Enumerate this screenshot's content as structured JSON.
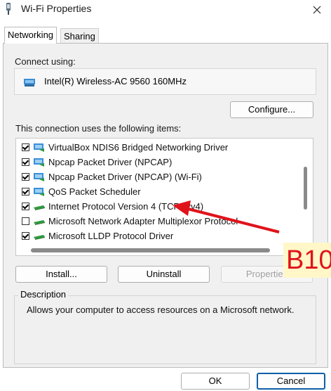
{
  "window": {
    "title": "Wi-Fi Properties"
  },
  "tabs": [
    {
      "label": "Networking",
      "active": true
    },
    {
      "label": "Sharing",
      "active": false
    }
  ],
  "connect_using": {
    "label": "Connect using:",
    "adapter": "Intel(R) Wireless-AC 9560 160MHz",
    "configure_label": "Configure..."
  },
  "items": {
    "label": "This connection uses the following items:",
    "rows": [
      {
        "label": "VirtualBox NDIS6 Bridged Networking Driver",
        "checked": true,
        "icon": "network-service-icon"
      },
      {
        "label": "Npcap Packet Driver (NPCAP)",
        "checked": true,
        "icon": "network-service-icon"
      },
      {
        "label": "Npcap Packet Driver (NPCAP) (Wi-Fi)",
        "checked": true,
        "icon": "network-service-icon"
      },
      {
        "label": "QoS Packet Scheduler",
        "checked": true,
        "icon": "network-service-icon"
      },
      {
        "label": "Internet Protocol Version 4 (TCP/IPv4)",
        "checked": true,
        "icon": "protocol-icon"
      },
      {
        "label": "Microsoft Network Adapter Multiplexor Protocol",
        "checked": false,
        "icon": "protocol-icon"
      },
      {
        "label": "Microsoft LLDP Protocol Driver",
        "checked": true,
        "icon": "protocol-icon"
      }
    ]
  },
  "buttons": {
    "install": "Install...",
    "uninstall": "Uninstall",
    "properties": "Properties",
    "ok": "OK",
    "cancel": "Cancel"
  },
  "description": {
    "legend": "Description",
    "text": "Allows your computer to access resources on a Microsoft network."
  },
  "annotation": {
    "badge": "B10",
    "badge_color": "#e0131b",
    "arrow_color": "#e0131b"
  }
}
